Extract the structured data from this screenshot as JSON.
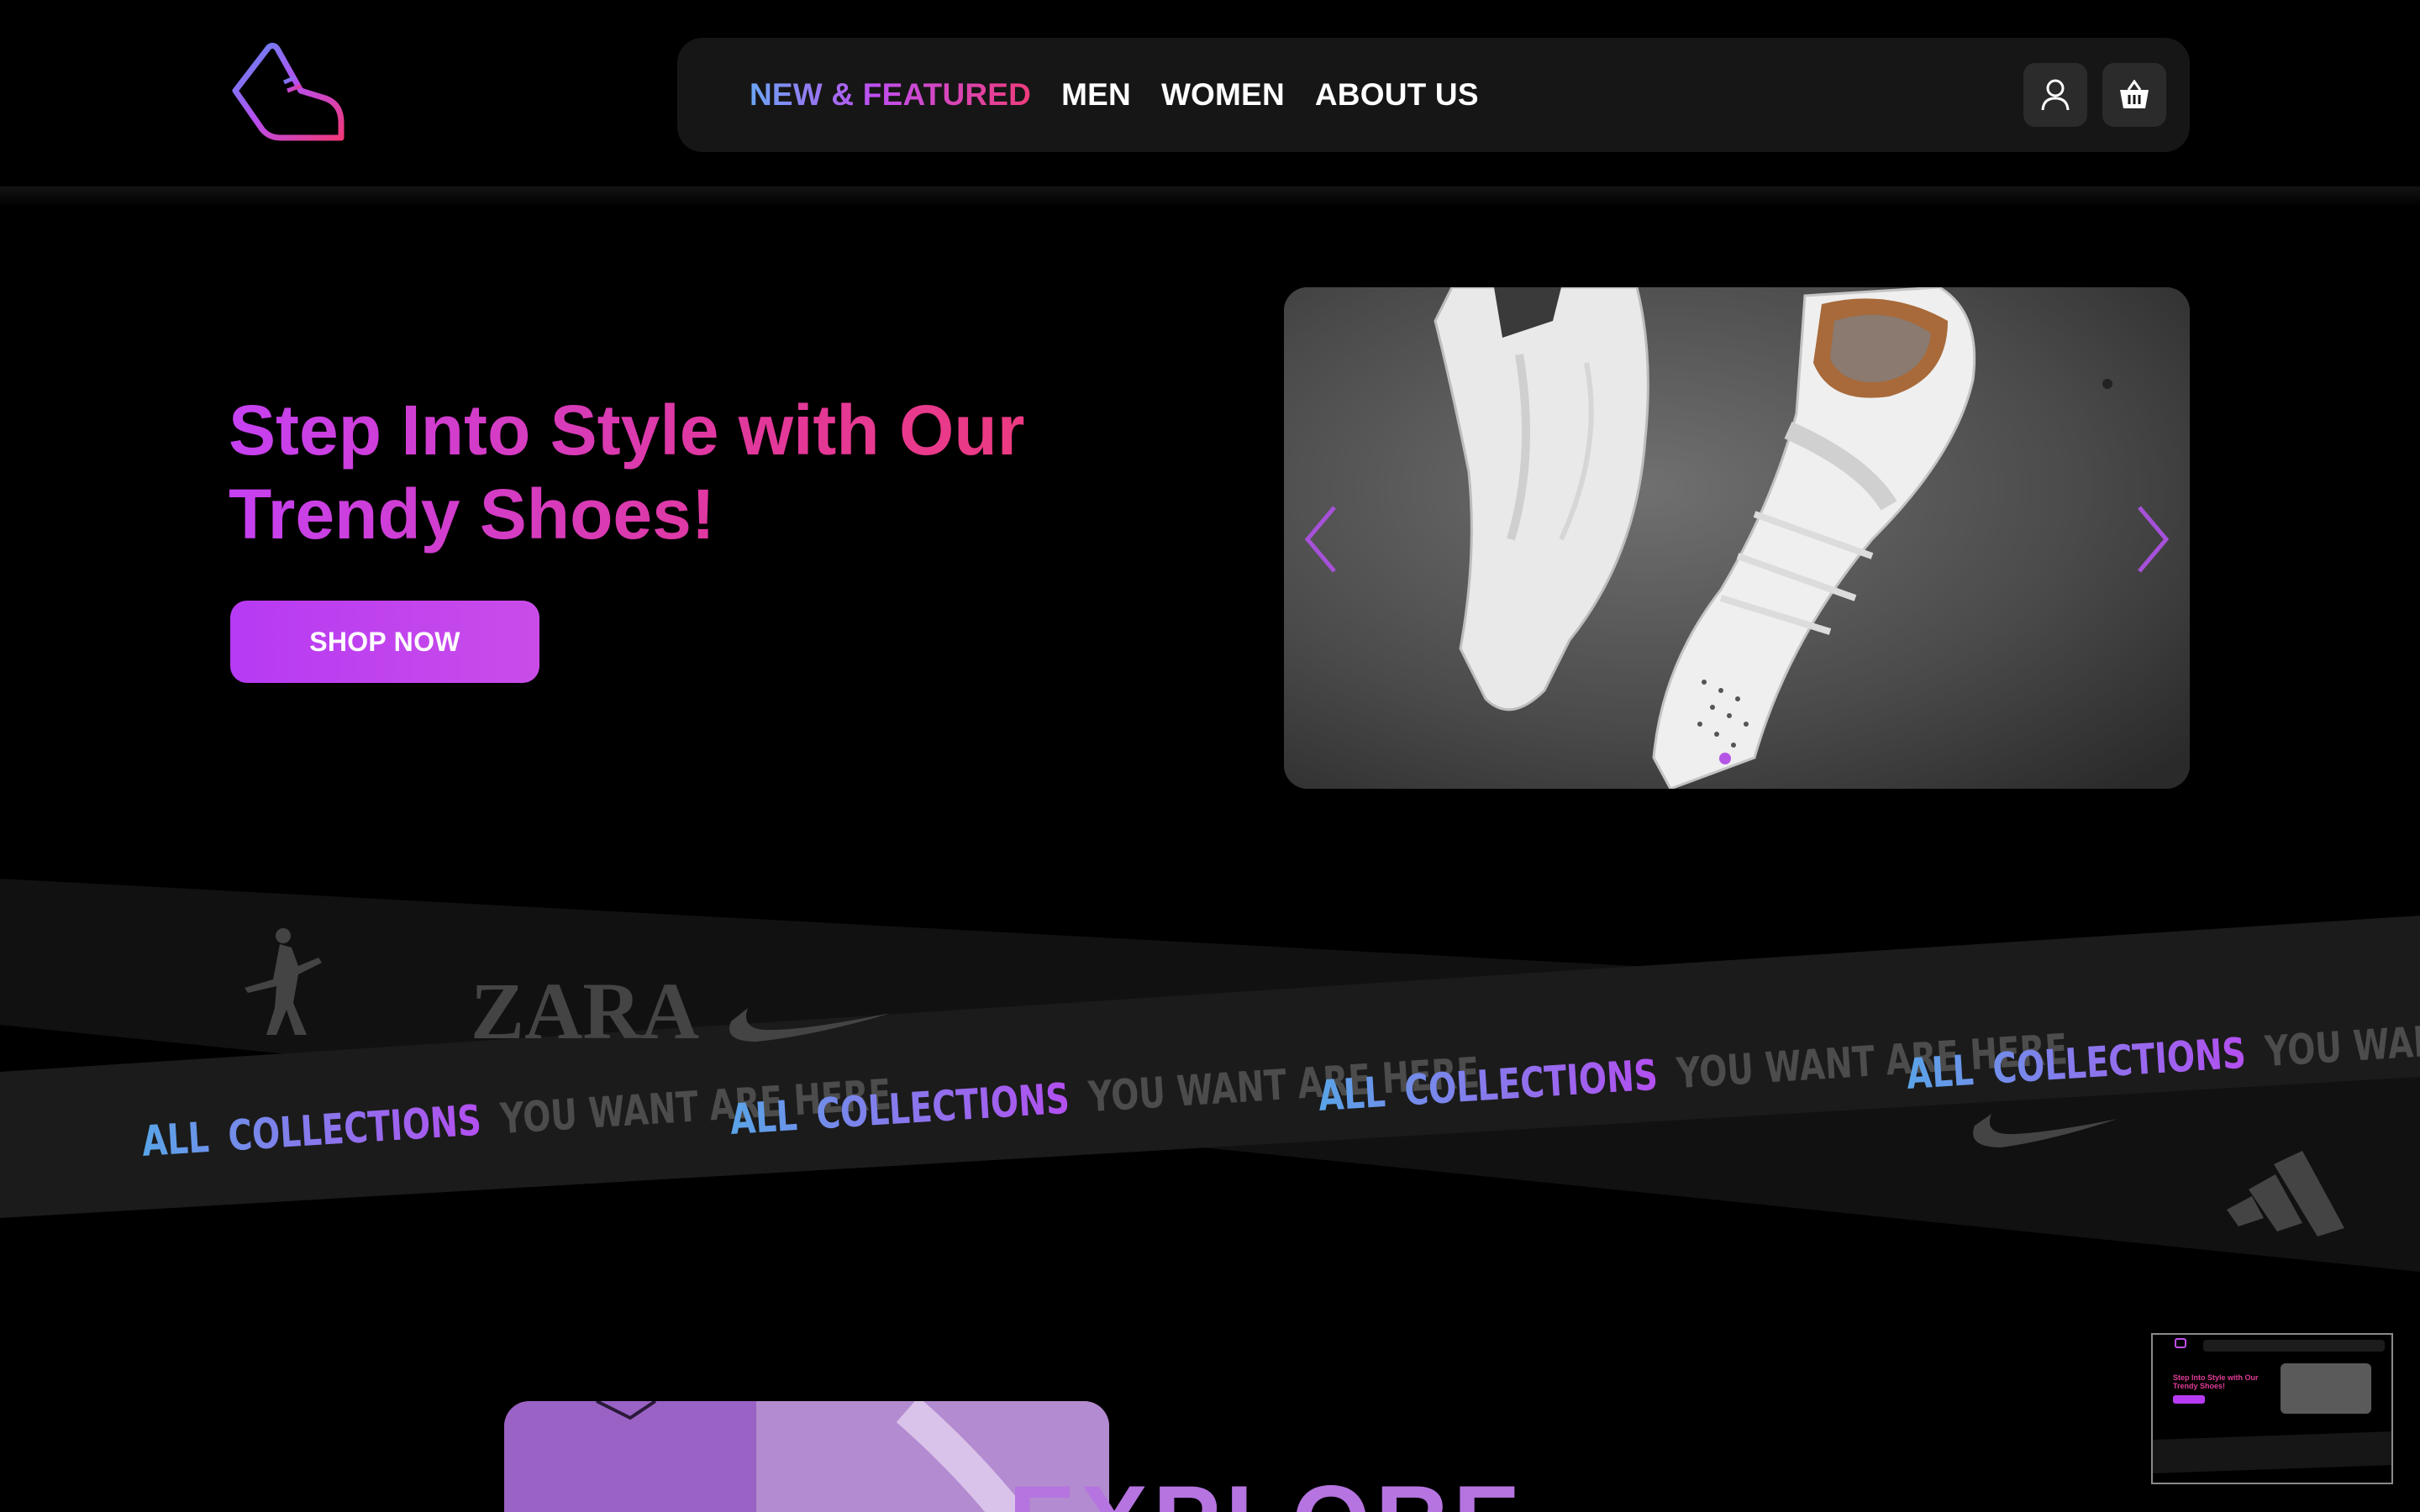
{
  "nav": {
    "items": [
      {
        "label": "NEW & FEATURED",
        "active": true
      },
      {
        "label": "MEN",
        "active": false
      },
      {
        "label": "WOMEN",
        "active": false
      },
      {
        "label": "ABOUT US",
        "active": false
      }
    ],
    "icons": {
      "user": "user-icon",
      "cart": "basket-icon"
    }
  },
  "hero": {
    "title_line1": "Step Into Style with Our",
    "title_line2": "Trendy Shoes!",
    "cta_label": "SHOP NOW"
  },
  "carousel": {
    "prev_icon": "chevron-left-icon",
    "next_icon": "chevron-right-icon",
    "slides_total": 1,
    "current_slide": 1
  },
  "band": {
    "tagline_gradient_part1": "ALL",
    "tagline_gradient_part2": "COLLECTIONS",
    "tagline_rest": "YOU WANT ARE HERE",
    "brands": [
      "jordan-logo",
      "ZARA",
      "nike-swoosh",
      "adidas-logo"
    ],
    "brand_text_zara": "ZARA"
  },
  "lower": {
    "heading_partial": "EXPLORE"
  },
  "colors": {
    "background": "#000000",
    "navbar_bg": "#161616",
    "accent_purple": "#b73af4",
    "accent_pink": "#f03a78",
    "accent_blue": "#6aa6f5"
  }
}
